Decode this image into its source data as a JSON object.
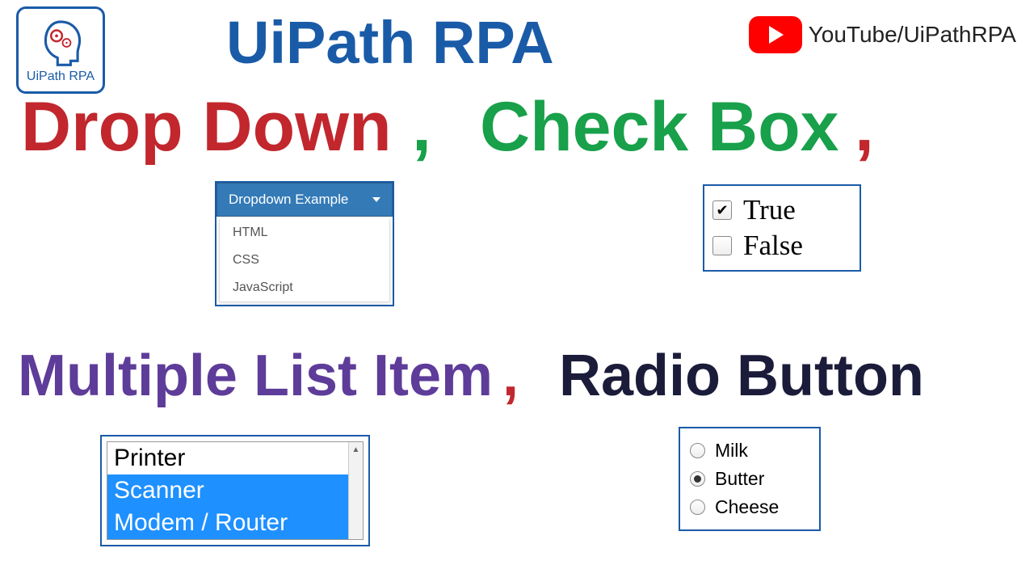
{
  "logo": {
    "text": "UiPath RPA"
  },
  "youtube": {
    "label": "YouTube/UiPathRPA"
  },
  "title": "UiPath RPA",
  "headings": {
    "drop_down": "Drop Down",
    "check_box": "Check Box",
    "multiple_list": "Multiple List Item",
    "radio_button": "Radio Button",
    "comma": ","
  },
  "dropdown": {
    "button_label": "Dropdown Example",
    "items": [
      "HTML",
      "CSS",
      "JavaScript"
    ]
  },
  "checkbox": {
    "items": [
      {
        "label": "True",
        "checked": true
      },
      {
        "label": "False",
        "checked": false
      }
    ]
  },
  "listbox": {
    "items": [
      {
        "label": "Printer",
        "selected": false
      },
      {
        "label": "Scanner",
        "selected": true
      },
      {
        "label": "Modem / Router",
        "selected": true
      }
    ]
  },
  "radio": {
    "items": [
      {
        "label": "Milk",
        "checked": false
      },
      {
        "label": "Butter",
        "checked": true
      },
      {
        "label": "Cheese",
        "checked": false
      }
    ]
  }
}
